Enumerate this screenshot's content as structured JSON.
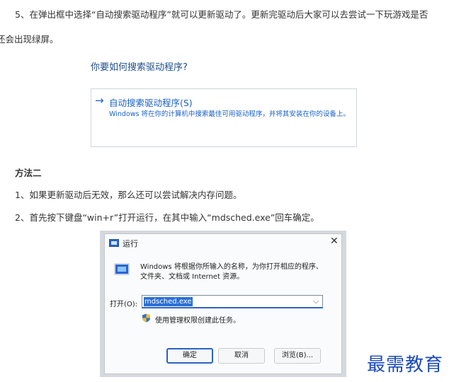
{
  "article": {
    "step5_line1": "5、在弹出框中选择“自动搜索驱动程序”就可以更新驱动了。更新完驱动后大家可以去尝试一下玩游戏是否",
    "step5_line2": "还会出现绿屏。",
    "method2_heading": "方法二",
    "method2_step1": "1、如果更新驱动后无效，那么还可以尝试解决内存问题。",
    "method2_step2": "2、首先按下键盘“win+r”打开运行，在其中输入“mdsched.exe”回车确定。"
  },
  "driver_dialog": {
    "heading": "你要如何搜索驱动程序?",
    "option_arrow": "→",
    "option_label": "自动搜索驱动程序(S)",
    "option_desc": "Windows 将在你的计算机中搜索最佳可用驱动程序，并将其安装在你的设备上。"
  },
  "run_dialog": {
    "title": "运行",
    "close_glyph": "✕",
    "description_line1": "Windows 将根据你所输入的名称，为你打开相应的程序、",
    "description_line2": "文件夹、文档或 Internet 资源。",
    "open_label": "打开(O):",
    "open_value": "mdsched.exe",
    "dropdown_glyph": "⌵",
    "admin_note": "使用管理权限创建此任务。",
    "ok_label": "确定",
    "cancel_label": "取消",
    "browse_label": "浏览(B)..."
  },
  "watermark": "最需教育"
}
